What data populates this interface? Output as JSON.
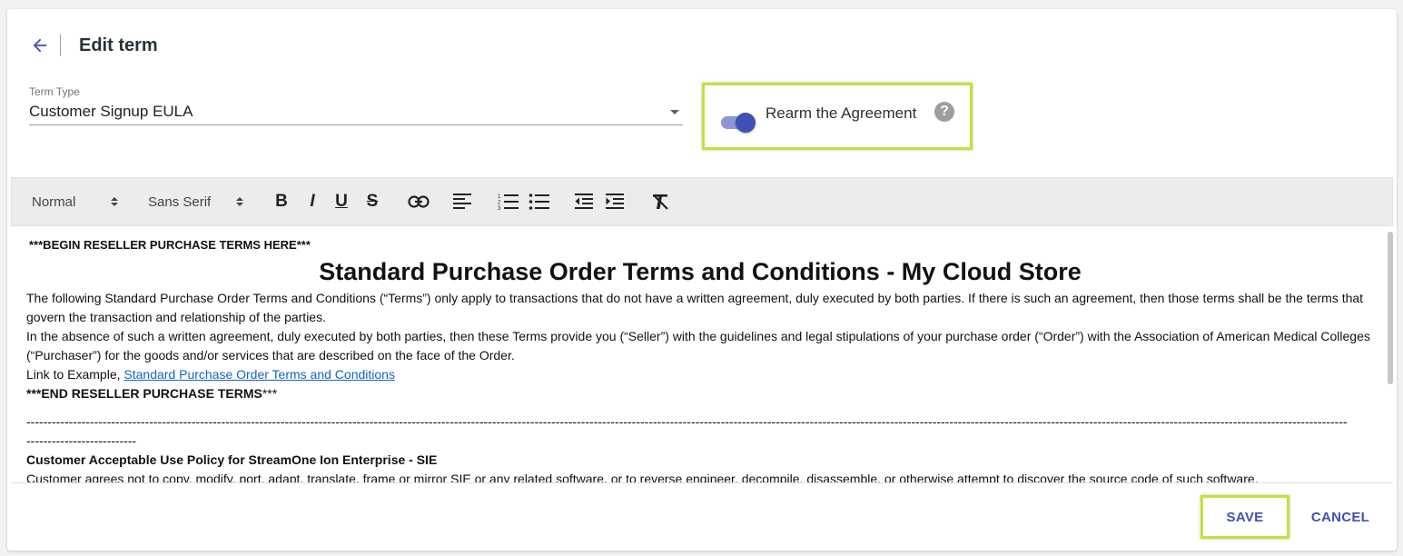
{
  "header": {
    "title": "Edit term",
    "back_icon": "arrow-left-icon"
  },
  "term_type": {
    "label": "Term Type",
    "value": "Customer Signup EULA"
  },
  "rearm": {
    "label": "Rearm the Agreement",
    "enabled": true,
    "help_glyph": "?"
  },
  "toolbar": {
    "size_select": "Normal",
    "font_select": "Sans Serif",
    "bold_glyph": "B",
    "italic_glyph": "I",
    "underline_glyph": "U",
    "strike_glyph": "S"
  },
  "editor": {
    "begin_marker": "***BEGIN RESELLER PURCHASE TERMS HERE***",
    "heading": "Standard Purchase Order Terms and Conditions - My Cloud Store",
    "para1": "The following Standard Purchase Order Terms and Conditions (“Terms”) only apply to transactions that do not have a written agreement, duly executed by both parties. If there is such an agreement, then those terms shall be the terms that govern the transaction and relationship of the parties.",
    "para2": "In the absence of such a written agreement, duly executed by both parties, then these Terms provide you (“Seller”) with the guidelines and legal stipulations of your purchase order (“Order”) with the Association of American Medical Colleges (“Purchaser”) for the goods and/or services that are described on the face of the Order.",
    "link_prefix": "Link to Example, ",
    "link_text": "Standard Purchase Order Terms and Conditions",
    "end_marker_bold": "***END RESELLER PURCHASE TERMS",
    "end_marker_rest": "***",
    "separator_line1": "------------------------------------------------------------------------------------------------------------------------------------------------------------------------------------------------------------------------------------------------------------------------------------------------------------------------",
    "separator_line2": "--------------------------",
    "policy_title": "Customer Acceptable Use Policy for StreamOne Ion Enterprise - SIE",
    "policy_text": "Customer agrees not to copy, modify, port, adapt, translate, frame or mirror SIE or any related software, or to reverse engineer, decompile, disassemble, or otherwise attempt to discover the source code of such software."
  },
  "actions": {
    "save": "SAVE",
    "cancel": "CANCEL"
  },
  "colors": {
    "accent": "#3f51b5",
    "highlight": "#c4e03a",
    "link": "#1565c0"
  }
}
